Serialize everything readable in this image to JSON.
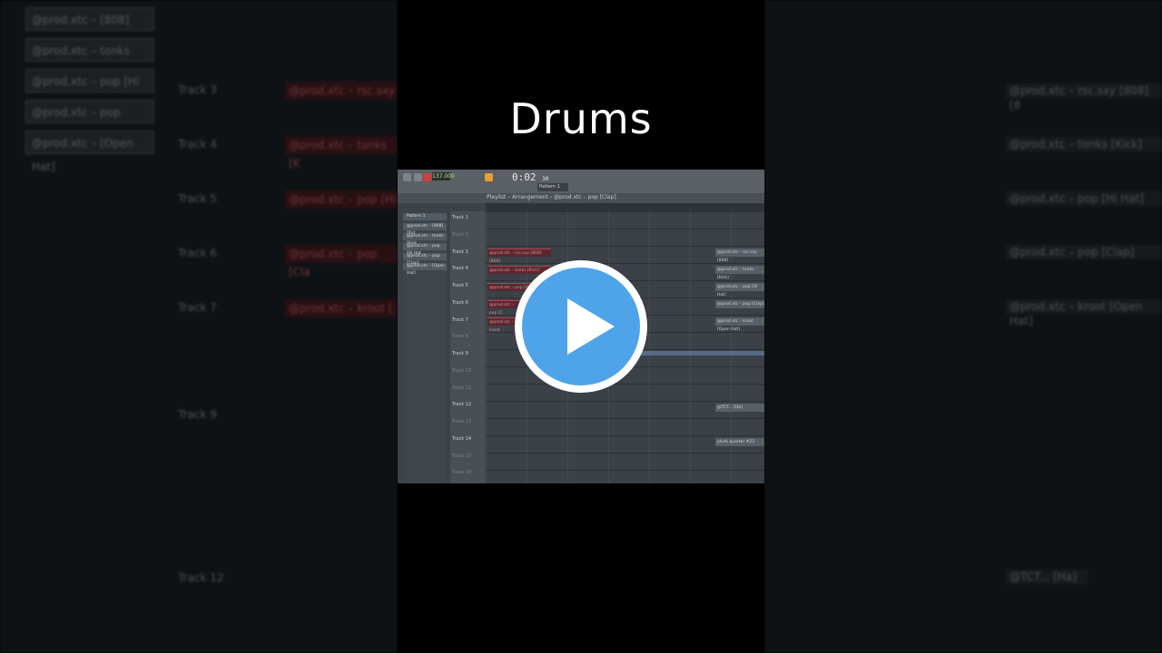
{
  "title": "Drums",
  "background": {
    "patterns": [
      "@prod.xtc – [808] (Rid",
      "@prod.xtc – tonks [Kic",
      "@prod.xtc – pop [Hi Hat",
      "@prod.xtc – pop [Clap]",
      "@prod.xtc – [Open Hat]"
    ],
    "track_labels": [
      "Track 3",
      "Track 4",
      "Track 5",
      "Track 6",
      "Track 7",
      "Track 9",
      "Track 12"
    ],
    "clips": [
      "@prod.xtc – rsc.sxy",
      "@prod.xtc – tonks [K",
      "@prod.xtc – pop [Hi",
      "@prod.xtc – pop [Cla",
      "@prod.xtc – kroot ["
    ],
    "right_clips": [
      "@prod.xtc – rsc.sxy [808] [8",
      "@prod.xtc – tonks [Kick]",
      "@prod.xtc – pop [Hi Hat]",
      "@prod.xtc – pop [Clap]",
      "@prod.xtc – kroot [Open Hat]",
      "@TCT... [Ha]"
    ]
  },
  "app": {
    "bpm": "137.000",
    "time": "0:02",
    "time_small": "30",
    "pattern": "Pattern 1",
    "breadcrumb": "Playlist – Arrangement › @prod.xtc – pop [Clap]",
    "picker_items": [
      "Pattern 1",
      "@prod.xtc – [808] [Rid",
      "@prod.xtc – tonks [Kick",
      "@prod.xtc – pop [Hi Hat",
      "@prod.xtc – pop [Clap]",
      "@prod.xtc – [Open Hat]"
    ],
    "tracks": [
      {
        "label": "Track 1",
        "dim": false
      },
      {
        "label": "Track 2",
        "dim": true
      },
      {
        "label": "Track 3",
        "dim": false
      },
      {
        "label": "Track 4",
        "dim": false
      },
      {
        "label": "Track 5",
        "dim": false
      },
      {
        "label": "Track 6",
        "dim": false
      },
      {
        "label": "Track 7",
        "dim": false
      },
      {
        "label": "Track 8",
        "dim": true
      },
      {
        "label": "Track 9",
        "dim": false
      },
      {
        "label": "Track 10",
        "dim": true
      },
      {
        "label": "Track 11",
        "dim": true
      },
      {
        "label": "Track 12",
        "dim": false
      },
      {
        "label": "Track 13",
        "dim": true
      },
      {
        "label": "Track 14",
        "dim": false
      },
      {
        "label": "Track 15",
        "dim": true
      },
      {
        "label": "Track 16",
        "dim": true
      }
    ],
    "clips_left": [
      "@prod.xtc – rsc.sxy [808] [808]",
      "@prod.xtc – tonks [Kick]",
      "@prod.xtc – pop [Hi Hat]",
      "@prod.xtc – pop [C",
      "@prod.xtc – kroot"
    ],
    "clips_right": [
      "@prod.xtc – rsc.sxy [808]",
      "@prod.xtc – tonks [Kick]",
      "@prod.xtc – pop [Hi Hat]",
      "@prod.xtc – pop [Clap]",
      "@prod.xtc – kroot [Open Hat]",
      "@TCT... [Ha]",
      "pluck quarter #22"
    ]
  },
  "colors": {
    "accent_play": "#4fa3e8",
    "clip_red": "#5a2830"
  }
}
